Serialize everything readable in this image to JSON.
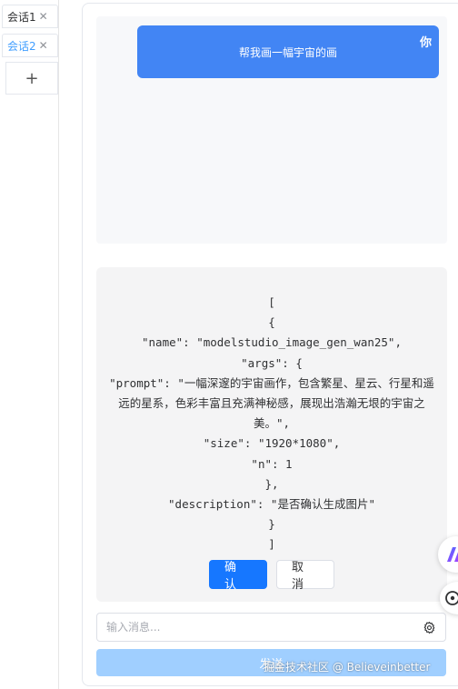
{
  "tabs": [
    {
      "label": "会话1",
      "close": "✕",
      "active": false
    },
    {
      "label": "会话2",
      "close": "✕",
      "active": true
    }
  ],
  "add_tab_label": "+",
  "user_message": {
    "text": "帮我画一幅宇宙的画",
    "sender": "你"
  },
  "tool_call_code": "[\n{\n\"name\": \"modelstudio_image_gen_wan25\",\n\"args\": {\n\"prompt\": \"一幅深邃的宇宙画作，包含繁星、星云、行星和遥远的星系，色彩丰富且充满神秘感，展现出浩瀚无垠的宇宙之美。\",\n\"size\": \"1920*1080\",\n\"n\": 1\n},\n\"description\": \"是否确认生成图片\"\n}\n]",
  "confirm_label": "确 认",
  "cancel_label": "取 消",
  "input": {
    "placeholder": "输入消息...",
    "value": ""
  },
  "send_label": "发送",
  "watermark": "掘金技术社区 @ Believeinbetter",
  "colors": {
    "accent": "#1677ff",
    "user_bubble": "#4285f4",
    "send_disabled": "#a0cfff"
  }
}
